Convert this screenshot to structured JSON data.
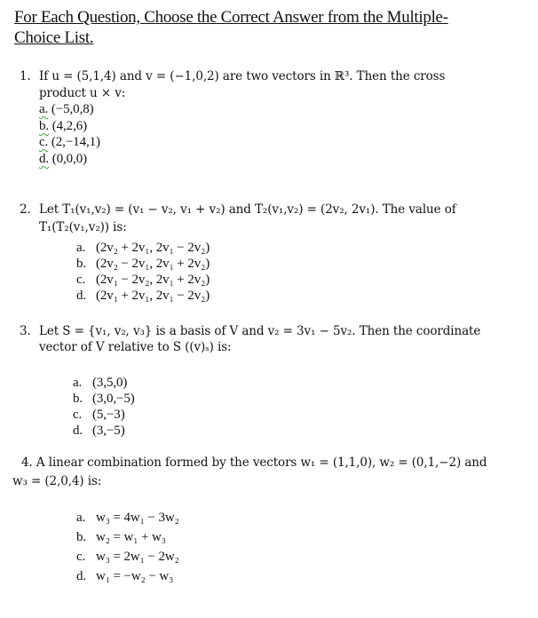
{
  "title": "For Each Question, Choose the Correct Answer from the Multiple-Choice List.",
  "title_line1": "For Each Question, Choose the Correct Answer from the Multiple-",
  "title_line2": "Choice List.",
  "questions": [
    {
      "number": "1.",
      "text_line1": "If u = (5,1,4) and v = (−1,0,2) are two vectors in ℝ³. Then the cross",
      "text_line2": "product u × v:",
      "options": [
        {
          "label": "a.",
          "value": "(−5,0,8)"
        },
        {
          "label": "b.",
          "value": "(4,2,6)"
        },
        {
          "label": "c.",
          "value": "(2,−14,1)"
        },
        {
          "label": "d.",
          "value": "(0,0,0)"
        }
      ]
    },
    {
      "number": "2.",
      "text_line1": "Let T₁(v₁,v₂) = (v₁ − v₂, v₁ + v₂) and T₂(v₁,v₂) = (2v₂, 2v₁). The value of",
      "text_line2": "T₁(T₂(v₁,v₂)) is:",
      "options": [
        {
          "label": "a.",
          "value": "(2v₂ + 2v₁, 2v₁ − 2v₂)"
        },
        {
          "label": "b.",
          "value": "(2v₂ − 2v₁, 2v₁ + 2v₂)"
        },
        {
          "label": "c.",
          "value": "(2v₁ − 2v₂, 2v₁ + 2v₂)"
        },
        {
          "label": "d.",
          "value": "(2v₁ + 2v₁, 2v₁ − 2v₂)"
        }
      ]
    },
    {
      "number": "3.",
      "text_line1": "Let S = {v₁, v₂, v₃} is a basis of V and v₂ = 3v₁ − 5v₂. Then the coordinate",
      "text_line2": "vector of V relative to S ((v)ₛ) is:",
      "options": [
        {
          "label": "a.",
          "value": "(3,5,0)"
        },
        {
          "label": "b.",
          "value": "(3,0,−5)"
        },
        {
          "label": "c.",
          "value": "(5,−3)"
        },
        {
          "label": "d.",
          "value": "(3,−5)"
        }
      ]
    },
    {
      "number": "4.",
      "text_line1": "A linear combination formed by the vectors w₁ = (1,1,0), w₂ = (0,1,−2) and",
      "text_line2": "w₃ = (2,0,4) is:",
      "options": [
        {
          "label": "a.",
          "value": "w₃ = 4w₁ − 3w₂"
        },
        {
          "label": "b.",
          "value": "w₂ = w₁ + w₃"
        },
        {
          "label": "c.",
          "value": "w₃ = 2w₁ − 2w₂"
        },
        {
          "label": "d.",
          "value": "w₁ = −w₂ − w₃"
        }
      ]
    }
  ]
}
